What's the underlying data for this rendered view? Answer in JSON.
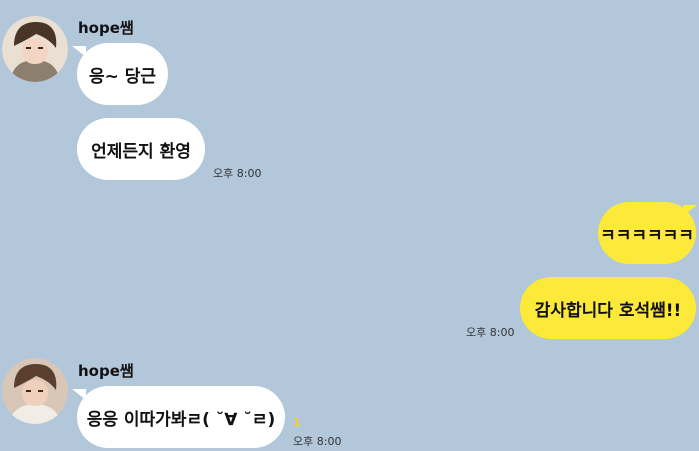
{
  "chat": {
    "groups": [
      {
        "sender": "hope쌤",
        "avatar_icon": "profile-photo-avatar",
        "messages": [
          "응~ 당근",
          "언제든지 환영"
        ],
        "time": "오후 8:00"
      },
      {
        "sender": "me",
        "messages": [
          "ㅋㅋㅋㅋㅋㅋ",
          "감사합니다 호석쌤!!"
        ],
        "time": "오후 8:00"
      },
      {
        "sender": "hope쌤",
        "avatar_icon": "profile-photo-avatar",
        "messages": [
          "응응 이따가봐ㄹ( ˘∀ ˘ㄹ)"
        ],
        "unread_count": "1",
        "time": "오후 8:00"
      }
    ]
  },
  "colors": {
    "background": "#b2c7da",
    "incoming_bubble": "#ffffff",
    "outgoing_bubble": "#fde93a",
    "unread": "#f3d323"
  }
}
